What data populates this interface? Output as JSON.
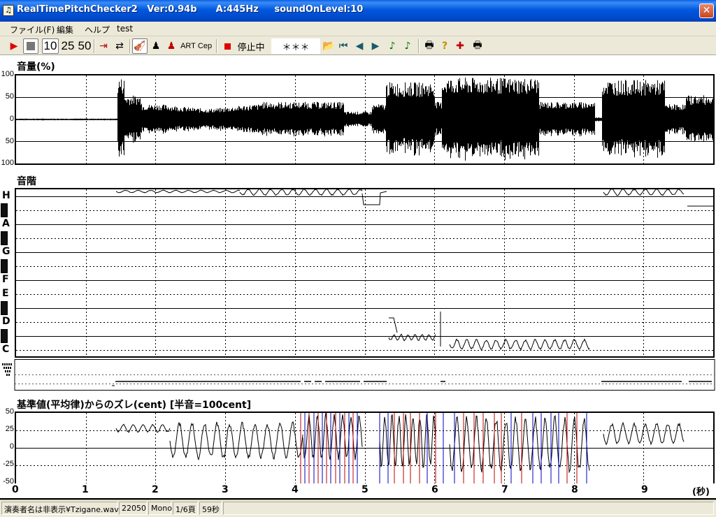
{
  "window": {
    "title": "RealTimePitchChecker2   Ver:0.94b      A:445Hz     soundOnLevel:10",
    "app_icon": "music-icon",
    "close_icon": "close-icon"
  },
  "menu": [
    "ファイル(F)",
    "編集",
    "ヘルプ",
    "test"
  ],
  "toolbar": {
    "rate_10": "10",
    "rate_25": "25",
    "rate_50": "50",
    "art_label": "ART",
    "cep_label": "Cep",
    "status_label": "停止中",
    "note_display": "＊＊＊"
  },
  "panels": {
    "volume": {
      "title": "音量(%)",
      "y_ticks": [
        "100",
        "50",
        "0",
        "50",
        "100"
      ]
    },
    "scale": {
      "title": "音階",
      "notes": [
        "H",
        "A",
        "G",
        "F",
        "E",
        "D",
        "C"
      ]
    },
    "deviation": {
      "title": "基準値(平均律)からのズレ(cent) [半音=100cent]",
      "y_ticks": [
        "50",
        "25",
        "0",
        "-25",
        "-50"
      ]
    }
  },
  "x_axis": {
    "ticks": [
      "0",
      "1",
      "2",
      "3",
      "4",
      "5",
      "6",
      "7",
      "8",
      "9"
    ],
    "unit": "(秒)"
  },
  "statusbar": {
    "file": "演奏者名は非表示¥Tzigane.wav",
    "rate": "22050",
    "channels": "Mono",
    "page": "1/6頁",
    "duration": "59秒"
  },
  "colors": {
    "titlebar": "#0054e3",
    "deviation_red": "#c00000",
    "deviation_blue": "#0000c0"
  }
}
